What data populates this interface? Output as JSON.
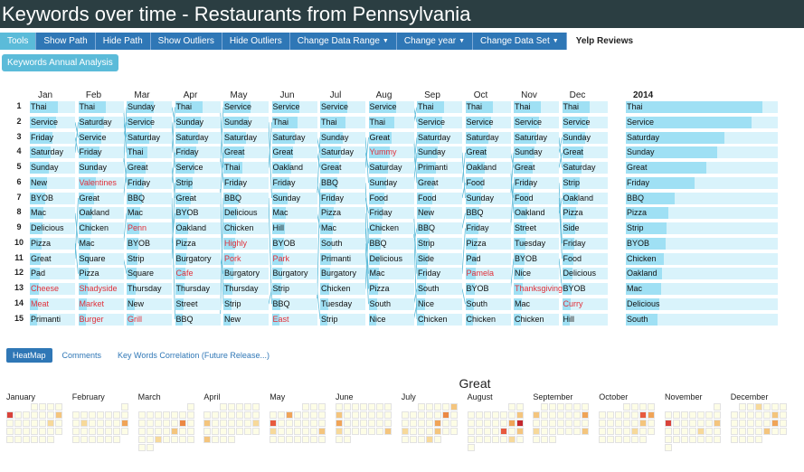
{
  "title": "Keywords over time - Restaurants from Pennsylvania",
  "menu": [
    {
      "label": "Tools",
      "name": "tools-menu",
      "caret": false,
      "style": "first"
    },
    {
      "label": "Show Path",
      "name": "show-path-button",
      "caret": false
    },
    {
      "label": "Hide Path",
      "name": "hide-path-button",
      "caret": false
    },
    {
      "label": "Show Outliers",
      "name": "show-outliers-button",
      "caret": false
    },
    {
      "label": "Hide Outliers",
      "name": "hide-outliers-button",
      "caret": false
    },
    {
      "label": "Change Data Range",
      "name": "change-data-range-dropdown",
      "caret": true
    },
    {
      "label": "Change year",
      "name": "change-year-dropdown",
      "caret": true
    },
    {
      "label": "Change Data Set",
      "name": "change-data-set-dropdown",
      "caret": true
    },
    {
      "label": "Yelp Reviews",
      "name": "data-set-name",
      "caret": false,
      "style": "plain"
    }
  ],
  "annual_button": "Keywords Annual Analysis",
  "months": [
    "Jan",
    "Feb",
    "Mar",
    "Apr",
    "May",
    "Jun",
    "Jul",
    "Aug",
    "Sep",
    "Oct",
    "Nov",
    "Dec"
  ],
  "ranks": [
    "1",
    "2",
    "3",
    "4",
    "5",
    "6",
    "7",
    "8",
    "9",
    "10",
    "11",
    "12",
    "13",
    "14",
    "15"
  ],
  "columns": [
    {
      "words": [
        "Thai",
        "Service",
        "Friday",
        "Saturday",
        "Sunday",
        "New",
        "BYOB",
        "Mac",
        "Delicious",
        "Pizza",
        "Great",
        "Pad",
        "Cheese",
        "Meat",
        "Primanti"
      ],
      "red": [
        12,
        13
      ],
      "bars": [
        0.62,
        0.58,
        0.5,
        0.46,
        0.42,
        0.38,
        0.34,
        0.3,
        0.28,
        0.26,
        0.24,
        0.22,
        0.2,
        0.18,
        0.16
      ]
    },
    {
      "words": [
        "Thai",
        "Saturday",
        "Service",
        "Friday",
        "Sunday",
        "Valentines",
        "Great",
        "Oakland",
        "Chicken",
        "Mac",
        "Square",
        "Pizza",
        "Shadyside",
        "Market",
        "Burger"
      ],
      "red": [
        5,
        12,
        13,
        14
      ],
      "bars": [
        0.6,
        0.56,
        0.5,
        0.46,
        0.42,
        0.38,
        0.34,
        0.3,
        0.28,
        0.26,
        0.24,
        0.22,
        0.2,
        0.18,
        0.16
      ]
    },
    {
      "words": [
        "Sunday",
        "Service",
        "Saturday",
        "Thai",
        "Great",
        "Friday",
        "BBQ",
        "Mac",
        "Penn",
        "BYOB",
        "Strip",
        "Square",
        "Thursday",
        "New",
        "Grill"
      ],
      "red": [
        8,
        14
      ],
      "bars": [
        0.6,
        0.56,
        0.5,
        0.46,
        0.42,
        0.38,
        0.34,
        0.3,
        0.28,
        0.26,
        0.24,
        0.22,
        0.2,
        0.18,
        0.16
      ]
    },
    {
      "words": [
        "Thai",
        "Sunday",
        "Saturday",
        "Friday",
        "Service",
        "Strip",
        "Great",
        "BYOB",
        "Oakland",
        "Pizza",
        "Burgatory",
        "Cafe",
        "Thursday",
        "Street",
        "BBQ"
      ],
      "red": [
        11
      ],
      "bars": [
        0.6,
        0.56,
        0.5,
        0.46,
        0.42,
        0.38,
        0.34,
        0.3,
        0.28,
        0.26,
        0.24,
        0.22,
        0.2,
        0.18,
        0.16
      ]
    },
    {
      "words": [
        "Service",
        "Sunday",
        "Saturday",
        "Great",
        "Thai",
        "Friday",
        "BBQ",
        "Delicious",
        "Chicken",
        "Highly",
        "Pork",
        "Burgatory",
        "Thursday",
        "Strip",
        "New"
      ],
      "red": [
        9,
        10
      ],
      "bars": [
        0.6,
        0.56,
        0.5,
        0.46,
        0.42,
        0.38,
        0.34,
        0.3,
        0.28,
        0.26,
        0.24,
        0.22,
        0.2,
        0.18,
        0.16
      ]
    },
    {
      "words": [
        "Service",
        "Thai",
        "Saturday",
        "Great",
        "Oakland",
        "Friday",
        "Sunday",
        "Mac",
        "Hill",
        "BYOB",
        "Park",
        "Burgatory",
        "Strip",
        "BBQ",
        "East"
      ],
      "red": [
        10,
        14
      ],
      "bars": [
        0.6,
        0.56,
        0.5,
        0.46,
        0.42,
        0.38,
        0.34,
        0.3,
        0.28,
        0.26,
        0.24,
        0.22,
        0.2,
        0.18,
        0.16
      ]
    },
    {
      "words": [
        "Service",
        "Thai",
        "Sunday",
        "Saturday",
        "Great",
        "BBQ",
        "Friday",
        "Pizza",
        "Mac",
        "South",
        "Primanti",
        "Burgatory",
        "Chicken",
        "Tuesday",
        "Strip"
      ],
      "red": [],
      "bars": [
        0.6,
        0.56,
        0.5,
        0.46,
        0.42,
        0.38,
        0.34,
        0.3,
        0.28,
        0.26,
        0.24,
        0.22,
        0.2,
        0.18,
        0.16
      ]
    },
    {
      "words": [
        "Service",
        "Thai",
        "Great",
        "Yummy",
        "Saturday",
        "Sunday",
        "Food",
        "Friday",
        "Chicken",
        "BBQ",
        "Delicious",
        "Mac",
        "Pizza",
        "South",
        "Nice"
      ],
      "red": [
        3
      ],
      "bars": [
        0.6,
        0.56,
        0.5,
        0.46,
        0.42,
        0.38,
        0.34,
        0.3,
        0.28,
        0.26,
        0.24,
        0.22,
        0.2,
        0.18,
        0.16
      ]
    },
    {
      "words": [
        "Thai",
        "Service",
        "Saturday",
        "Sunday",
        "Primanti",
        "Great",
        "Food",
        "New",
        "BBQ",
        "Strip",
        "Side",
        "Friday",
        "South",
        "Nice",
        "Chicken"
      ],
      "red": [],
      "bars": [
        0.6,
        0.56,
        0.5,
        0.46,
        0.42,
        0.38,
        0.34,
        0.3,
        0.28,
        0.26,
        0.24,
        0.22,
        0.2,
        0.18,
        0.16
      ]
    },
    {
      "words": [
        "Thai",
        "Service",
        "Saturday",
        "Great",
        "Oakland",
        "Food",
        "Sunday",
        "BBQ",
        "Friday",
        "Pizza",
        "Pad",
        "Pamela",
        "BYOB",
        "South",
        "Chicken"
      ],
      "red": [
        11
      ],
      "bars": [
        0.6,
        0.56,
        0.5,
        0.46,
        0.42,
        0.38,
        0.34,
        0.3,
        0.28,
        0.26,
        0.24,
        0.22,
        0.2,
        0.18,
        0.16
      ]
    },
    {
      "words": [
        "Thai",
        "Service",
        "Saturday",
        "Sunday",
        "Great",
        "Friday",
        "Food",
        "Oakland",
        "Street",
        "Tuesday",
        "BYOB",
        "Nice",
        "Thanksgiving",
        "Mac",
        "Chicken"
      ],
      "red": [
        12
      ],
      "bars": [
        0.6,
        0.56,
        0.5,
        0.46,
        0.42,
        0.38,
        0.34,
        0.3,
        0.28,
        0.26,
        0.24,
        0.22,
        0.2,
        0.18,
        0.16
      ]
    },
    {
      "words": [
        "Thai",
        "Service",
        "Sunday",
        "Great",
        "Saturday",
        "Strip",
        "Oakland",
        "Pizza",
        "Side",
        "Friday",
        "Food",
        "Delicious",
        "BYOB",
        "Curry",
        "Hill"
      ],
      "red": [
        13
      ],
      "bars": [
        0.6,
        0.56,
        0.5,
        0.46,
        0.42,
        0.38,
        0.34,
        0.3,
        0.28,
        0.26,
        0.24,
        0.22,
        0.2,
        0.18,
        0.16
      ]
    }
  ],
  "year": {
    "label": "2014",
    "words": [
      "Thai",
      "Service",
      "Saturday",
      "Sunday",
      "Great",
      "Friday",
      "BBQ",
      "Pizza",
      "Strip",
      "BYOB",
      "Chicken",
      "Oakland",
      "Mac",
      "Delicious",
      "South"
    ],
    "bars": [
      0.9,
      0.83,
      0.65,
      0.6,
      0.53,
      0.45,
      0.32,
      0.28,
      0.27,
      0.26,
      0.25,
      0.24,
      0.23,
      0.22,
      0.21
    ]
  },
  "tabs": [
    {
      "label": "HeatMap",
      "name": "tab-heatmap",
      "active": true
    },
    {
      "label": "Comments",
      "name": "tab-comments",
      "active": false
    },
    {
      "label": "Key Words Correlation (Future Release...)",
      "name": "tab-keyword-correlation",
      "active": false
    }
  ],
  "heatmap": {
    "title": "Great",
    "months": [
      {
        "label": "January",
        "start": 3,
        "days": 31,
        "hot": {
          "4": "#d9433a",
          "10": "#f4c57d",
          "16": "#f7d99a"
        }
      },
      {
        "label": "February",
        "start": 6,
        "days": 28,
        "hot": {
          "14": "#f0a457",
          "9": "#f7d99a"
        }
      },
      {
        "label": "March",
        "start": 6,
        "days": 31,
        "hot": {
          "13": "#ec8844",
          "19": "#f4c57d",
          "24": "#f7d99a"
        }
      },
      {
        "label": "April",
        "start": 2,
        "days": 30,
        "hot": {
          "12": "#f4c57d",
          "18": "#f7d99a",
          "26": "#f4c57d"
        }
      },
      {
        "label": "May",
        "start": 4,
        "days": 31,
        "hot": {
          "5": "#f0a457",
          "10": "#e85a3e",
          "17": "#f7d99a",
          "23": "#f4c57d"
        }
      },
      {
        "label": "June",
        "start": 0,
        "days": 30,
        "hot": {
          "7": "#f4c57d",
          "14": "#f0a457",
          "21": "#f7d99a",
          "27": "#f4c57d"
        }
      },
      {
        "label": "July",
        "start": 2,
        "days": 31,
        "hot": {
          "4": "#f4c57d",
          "10": "#ec8844",
          "16": "#f0a457",
          "19": "#f7d99a",
          "23": "#f4c57d",
          "29": "#f7d99a"
        }
      },
      {
        "label": "August",
        "start": 5,
        "days": 31,
        "hot": {
          "8": "#f4c57d",
          "14": "#f0a457",
          "15": "#c4272e",
          "20": "#e85a3e",
          "22": "#f4c57d",
          "28": "#f7d99a"
        }
      },
      {
        "label": "September",
        "start": 1,
        "days": 30,
        "hot": {
          "6": "#f4c57d",
          "12": "#f0a457",
          "20": "#f7d99a",
          "26": "#f4c57d"
        }
      },
      {
        "label": "October",
        "start": 3,
        "days": 31,
        "hot": {
          "9": "#e85a3e",
          "10": "#f0a457",
          "16": "#f4c57d",
          "22": "#f7d99a"
        }
      },
      {
        "label": "November",
        "start": 6,
        "days": 30,
        "hot": {
          "8": "#d9433a",
          "14": "#f4c57d",
          "19": "#f7d99a"
        }
      },
      {
        "label": "December",
        "start": 1,
        "days": 31,
        "hot": {
          "2": "#f7d99a",
          "11": "#f4c57d",
          "18": "#f0a457",
          "24": "#f4c57d"
        }
      }
    ]
  },
  "colors": {
    "title_bg": "#2b3e42",
    "menu_bg": "#2f77b6",
    "accent": "#5bbbd9",
    "cell_bg": "#d9f3fb",
    "bar": "#9fe0f4",
    "path": "#5bbbd9",
    "red": "#e0303a"
  }
}
